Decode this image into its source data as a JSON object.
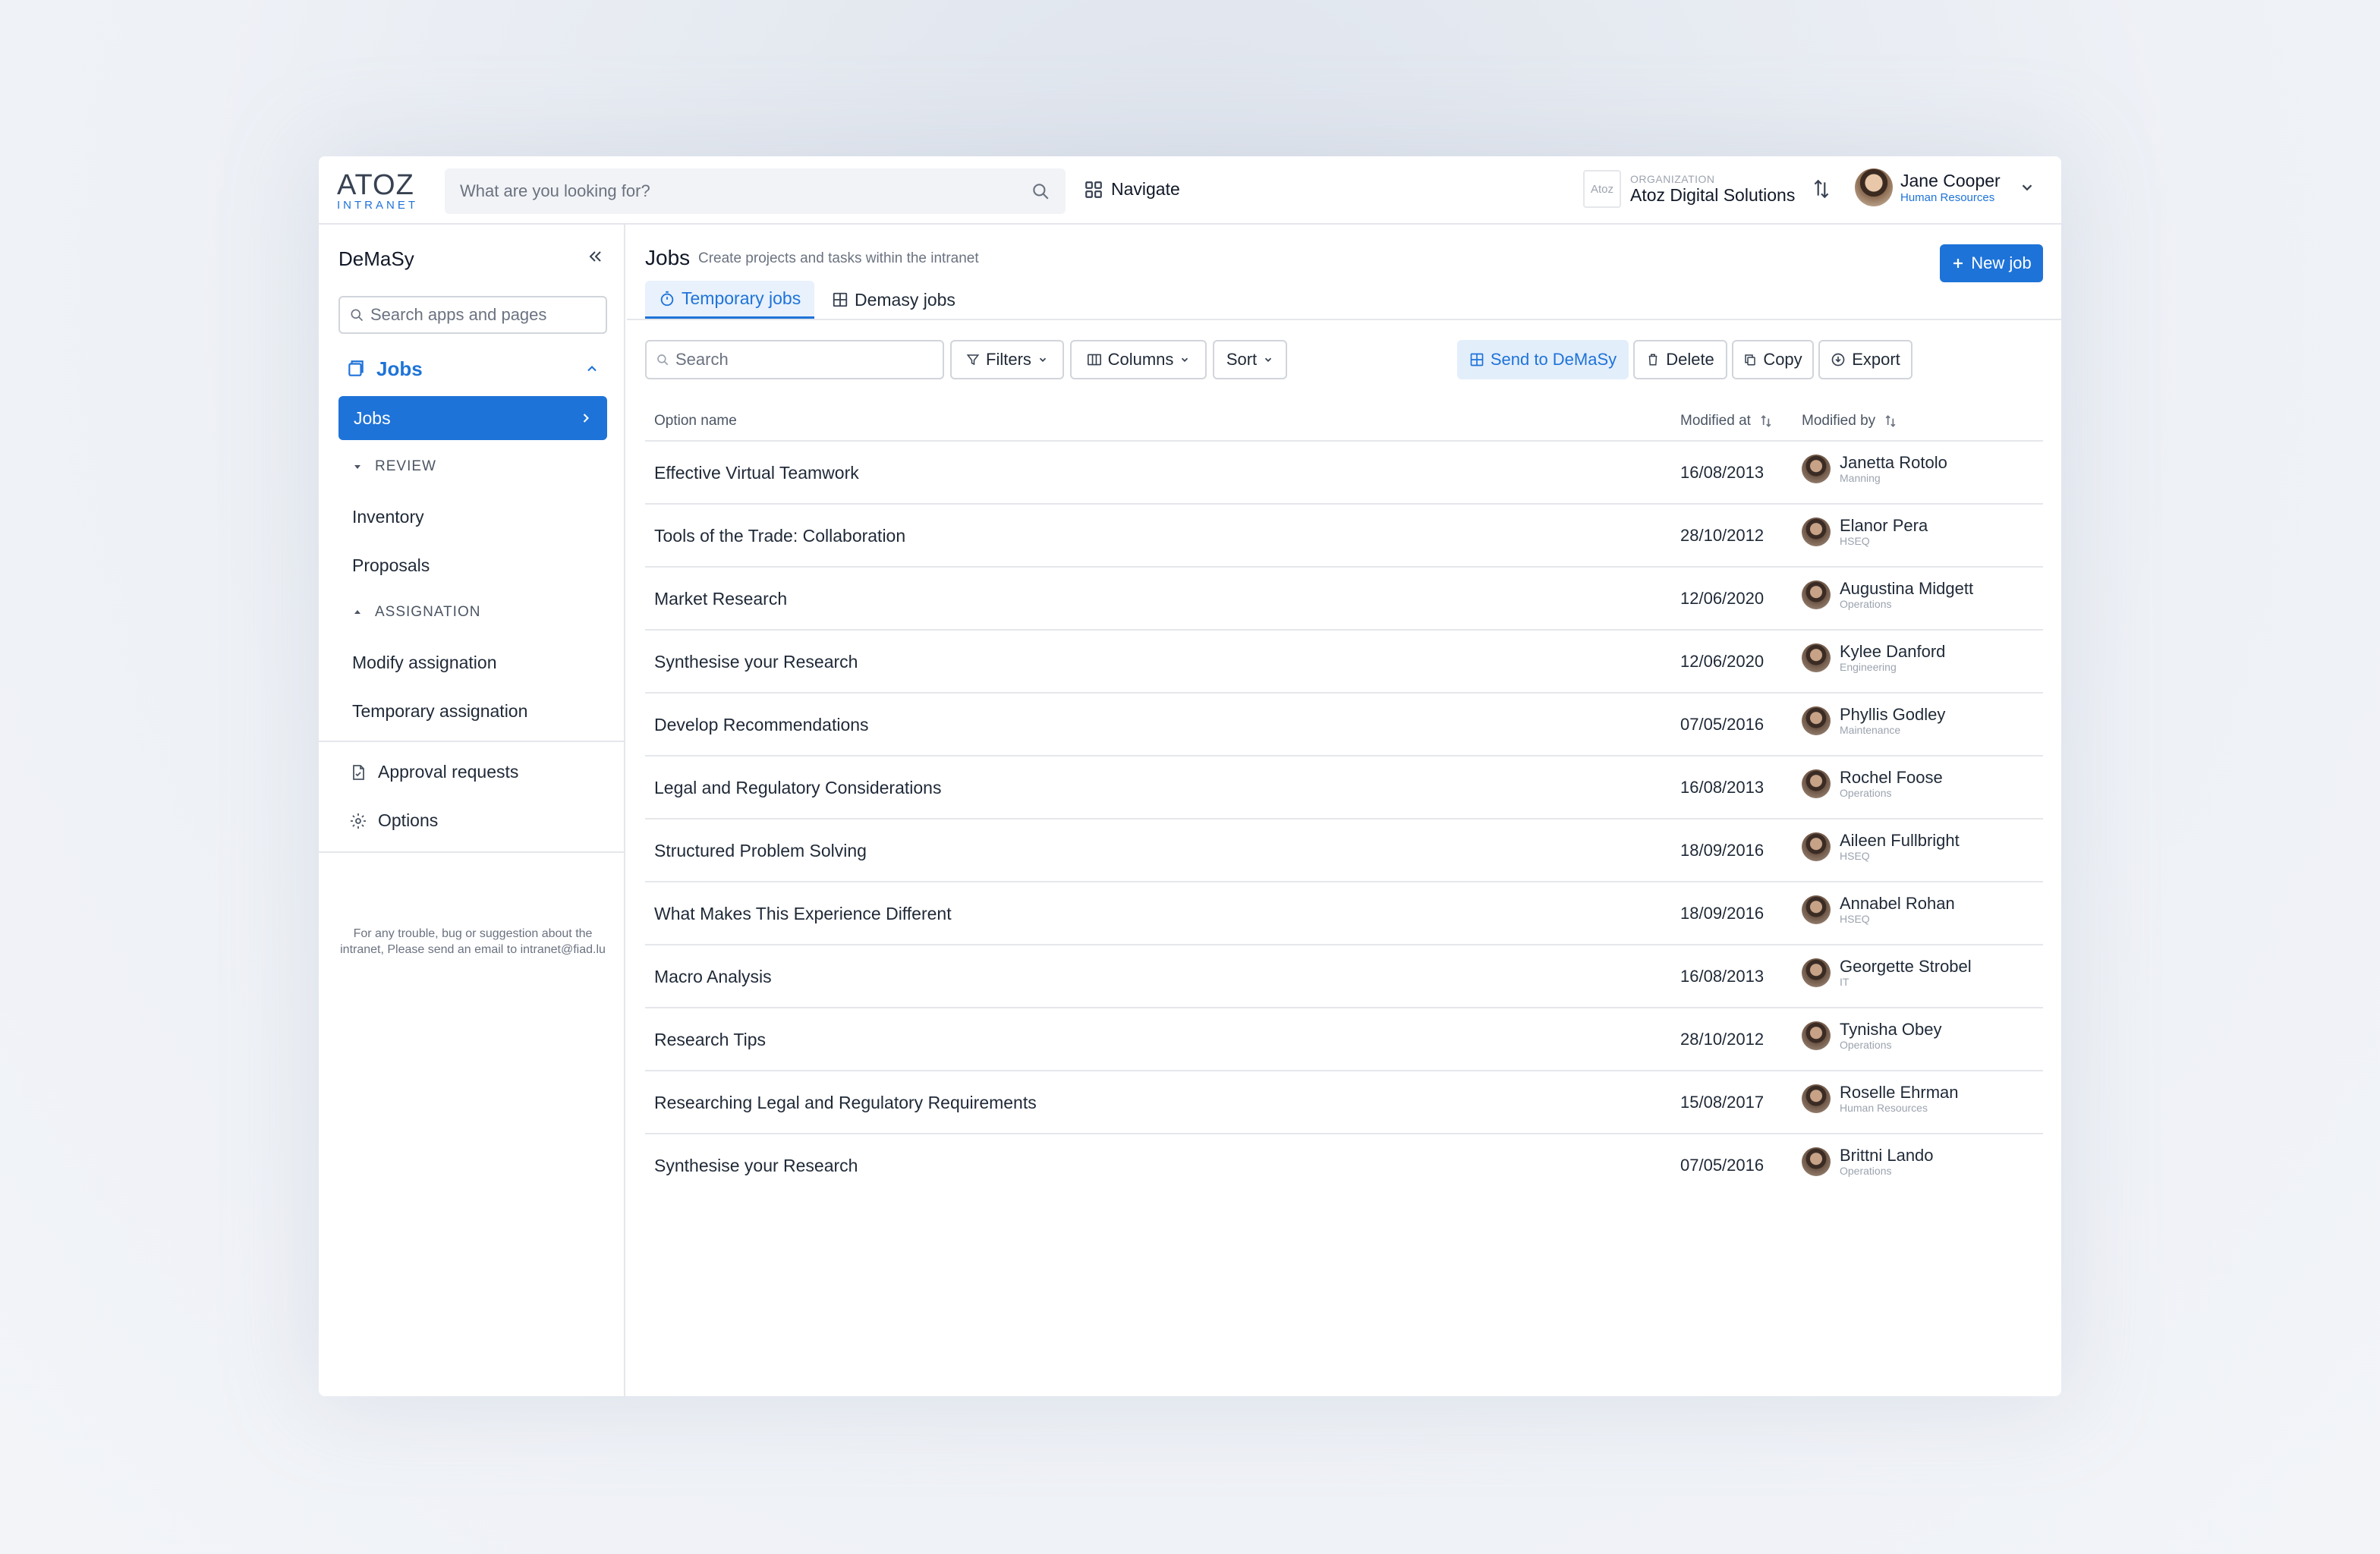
{
  "app": {
    "logo_main": "ATOZ",
    "logo_sub": "INTRANET",
    "search_placeholder": "What are you looking for?",
    "navigate_label": "Navigate",
    "org_label": "ORGANIZATION",
    "org_name": "Atoz Digital Solutions",
    "org_logo_text": "Atoz",
    "user_name": "Jane Cooper",
    "user_role": "Human Resources"
  },
  "sidebar": {
    "title": "DeMaSy",
    "search_placeholder": "Search apps and pages",
    "section_label": "Jobs",
    "active_item": "Jobs",
    "group_review": "REVIEW",
    "items_review": [
      "Inventory",
      "Proposals"
    ],
    "group_assignation": "ASSIGNATION",
    "items_assignation": [
      "Modify assignation",
      "Temporary assignation"
    ],
    "approval_label": "Approval requests",
    "options_label": "Options",
    "footer_text": "For any trouble, bug or suggestion about the intranet, Please send an email to intranet@fiad.lu"
  },
  "main": {
    "title": "Jobs",
    "subtitle": "Create projects and tasks within the intranet",
    "new_job_label": "New job",
    "tabs": [
      "Temporary jobs",
      "Demasy jobs"
    ],
    "toolbar": {
      "search_placeholder": "Search",
      "filters": "Filters",
      "columns": "Columns",
      "sort": "Sort",
      "send": "Send to DeMaSy",
      "delete": "Delete",
      "copy": "Copy",
      "export": "Export"
    },
    "columns": {
      "name": "Option name",
      "modified_at": "Modified at",
      "modified_by": "Modified by"
    },
    "rows": [
      {
        "name": "Effective Virtual Teamwork",
        "date": "16/08/2013",
        "user": "Janetta Rotolo",
        "dept": "Manning"
      },
      {
        "name": "Tools of the Trade: Collaboration",
        "date": "28/10/2012",
        "user": "Elanor Pera",
        "dept": "HSEQ"
      },
      {
        "name": "Market Research",
        "date": "12/06/2020",
        "user": "Augustina Midgett",
        "dept": "Operations"
      },
      {
        "name": "Synthesise your Research",
        "date": "12/06/2020",
        "user": "Kylee Danford",
        "dept": "Engineering"
      },
      {
        "name": "Develop Recommendations",
        "date": "07/05/2016",
        "user": "Phyllis Godley",
        "dept": "Maintenance"
      },
      {
        "name": "Legal and Regulatory Considerations",
        "date": "16/08/2013",
        "user": "Rochel Foose",
        "dept": "Operations"
      },
      {
        "name": "Structured Problem Solving",
        "date": "18/09/2016",
        "user": "Aileen Fullbright",
        "dept": "HSEQ"
      },
      {
        "name": "What Makes This Experience Different",
        "date": "18/09/2016",
        "user": "Annabel Rohan",
        "dept": "HSEQ"
      },
      {
        "name": "Macro Analysis",
        "date": "16/08/2013",
        "user": "Georgette Strobel",
        "dept": "IT"
      },
      {
        "name": "Research Tips",
        "date": "28/10/2012",
        "user": "Tynisha Obey",
        "dept": "Operations"
      },
      {
        "name": "Researching Legal and Regulatory Requirements",
        "date": "15/08/2017",
        "user": "Roselle Ehrman",
        "dept": "Human Resources"
      },
      {
        "name": "Synthesise your Research",
        "date": "07/05/2016",
        "user": "Brittni Lando",
        "dept": "Operations"
      }
    ]
  },
  "colors": {
    "accent": "#1e73d8",
    "background": "#eef1f6",
    "surface": "#ffffff",
    "border": "#e5e7eb"
  }
}
